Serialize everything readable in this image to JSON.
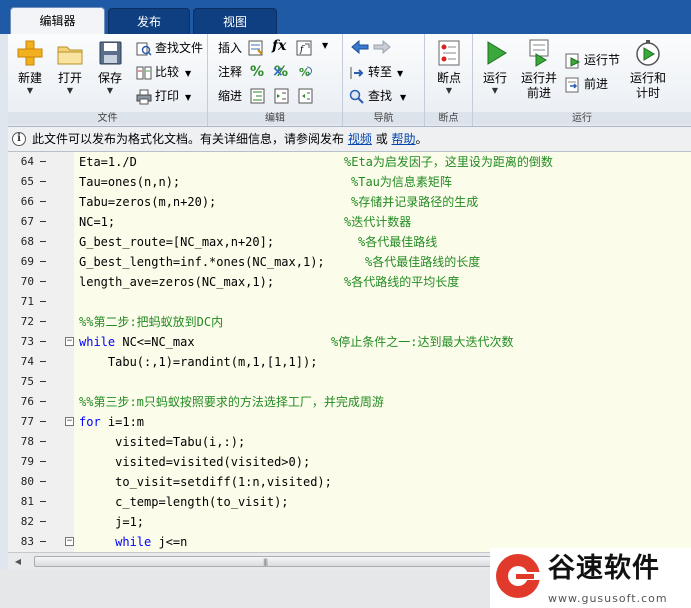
{
  "tabs": [
    {
      "label": "编辑器",
      "active": true
    },
    {
      "label": "发布",
      "active": false
    },
    {
      "label": "视图",
      "active": false
    }
  ],
  "ribbon": {
    "file": {
      "caption": "文件",
      "new_label": "新建",
      "open_label": "打开",
      "save_label": "保存",
      "find_files_label": "查找文件",
      "compare_label": "比较",
      "print_label": "打印"
    },
    "edit": {
      "caption": "编辑",
      "insert_label": "插入",
      "comment_label": "注释",
      "indent_label": "缩进"
    },
    "navigate": {
      "caption": "导航",
      "goto_label": "转至",
      "find_label": "查找"
    },
    "breakpoints": {
      "caption": "断点",
      "breakpoints_label": "断点"
    },
    "run": {
      "caption": "运行",
      "run_label": "运行",
      "run_advance_label": "运行并前进",
      "run_section_label": "运行节",
      "advance_label": "前进",
      "run_time_label": "运行和计时"
    }
  },
  "infobar": {
    "text": "此文件可以发布为格式化文档。有关详细信息，请参阅发布",
    "video_link": "视频",
    "or_text": "或",
    "help_link": "帮助",
    "end_text": "。"
  },
  "editor": {
    "lines": [
      {
        "num": "64",
        "code": "Eta=1./D",
        "comment": "%Eta为启发因子，这里设为距离的倒数"
      },
      {
        "num": "65",
        "code": "Tau=ones(n,n);",
        "comment": "%Tau为信息素矩阵"
      },
      {
        "num": "66",
        "code": "Tabu=zeros(m,n+20);",
        "comment": "%存储并记录路径的生成"
      },
      {
        "num": "67",
        "code": "NC=1;",
        "comment": "%迭代计数器"
      },
      {
        "num": "68",
        "code": "G_best_route=[NC_max,n+20];",
        "comment": "%各代最佳路线"
      },
      {
        "num": "69",
        "code": "G_best_length=inf.*ones(NC_max,1);",
        "comment": "%各代最佳路线的长度"
      },
      {
        "num": "70",
        "code": "length_ave=zeros(NC_max,1);",
        "comment": "%各代路线的平均长度"
      },
      {
        "num": "71",
        "code": "",
        "comment": ""
      },
      {
        "num": "72",
        "code": "%%第二步:把蚂蚁放到DC内",
        "comment": ""
      },
      {
        "num": "73",
        "code": "while NC<=NC_max",
        "comment": "%停止条件之一:达到最大迭代次数"
      },
      {
        "num": "74",
        "code": "    Tabu(:,1)=randint(m,1,[1,1]);",
        "comment": ""
      },
      {
        "num": "75",
        "code": "",
        "comment": ""
      },
      {
        "num": "76",
        "code": "%%第三步:m只蚂蚁按照要求的方法选择工厂，并完成周游",
        "comment": ""
      },
      {
        "num": "77",
        "code": "for i=1:m",
        "comment": ""
      },
      {
        "num": "78",
        "code": "     visited=Tabu(i,:);",
        "comment": ""
      },
      {
        "num": "79",
        "code": "     visited=visited(visited>0);",
        "comment": ""
      },
      {
        "num": "80",
        "code": "     to_visit=setdiff(1:n,visited);",
        "comment": ""
      },
      {
        "num": "81",
        "code": "     c_temp=length(to_visit);",
        "comment": ""
      },
      {
        "num": "82",
        "code": "     j=1;",
        "comment": ""
      },
      {
        "num": "83",
        "code": "     while j<=n",
        "comment": ""
      }
    ]
  },
  "watermark": {
    "brand": "谷速软件",
    "url": "www.gususoft.com"
  },
  "colors": {
    "tab_bar": "#1f5aa6",
    "editor_bg": "#fcfcea",
    "keyword": "#0000ff",
    "comment": "#228b22",
    "logo_red": "#e23a2a"
  }
}
